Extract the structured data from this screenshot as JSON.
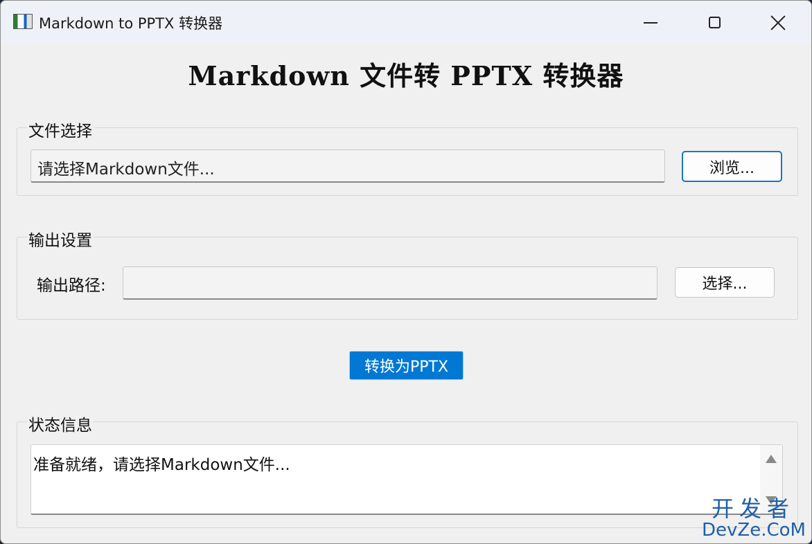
{
  "window": {
    "title": "Markdown to PPTX 转换器",
    "app_icon": "pptx-app-icon",
    "controls": [
      "minimize-icon",
      "maximize-icon",
      "close-icon"
    ]
  },
  "header": {
    "title": "Markdown 文件转 PPTX 转换器"
  },
  "file_section": {
    "label": "文件选择",
    "placeholder": "请选择Markdown文件...",
    "value": "",
    "browse_label": "浏览..."
  },
  "output_section": {
    "label": "输出设置",
    "path_label": "输出路径:",
    "path_value": "",
    "choose_label": "选择..."
  },
  "convert_label": "转换为PPTX",
  "status_section": {
    "label": "状态信息",
    "text": "准备就绪，请选择Markdown文件..."
  },
  "watermark": {
    "line1": "开发者",
    "line2": "DevZe.CoM"
  },
  "colors": {
    "accent": "#0078d4",
    "window_bg": "#f0f0f0",
    "titlebar_bg": "#eef1f7",
    "watermark": "#1f5fa8"
  }
}
